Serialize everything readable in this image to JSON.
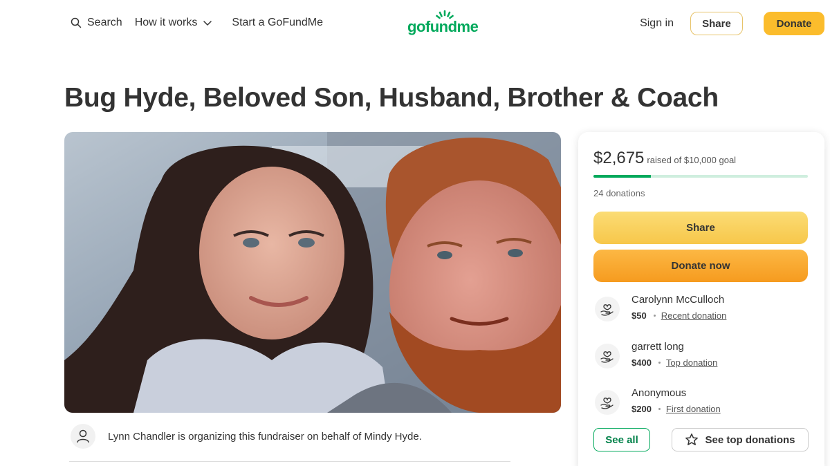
{
  "nav": {
    "search_label": "Search",
    "how_it_works_label": "How it works",
    "start_label": "Start a GoFundMe",
    "logo_text": "gofundme",
    "signin_label": "Sign in",
    "share_label": "Share",
    "donate_label": "Donate"
  },
  "campaign": {
    "title": "Bug Hyde, Beloved Son, Husband, Brother & Coach",
    "organizer_text": "Lynn Chandler is organizing this fundraiser on behalf of Mindy Hyde."
  },
  "donation_card": {
    "raised_amount": "$2,675",
    "goal_text": "raised of $10,000 goal",
    "progress_fraction": 0.2675,
    "donations_count": "24 donations",
    "share_label": "Share",
    "donate_label": "Donate now",
    "donors": [
      {
        "name": "Carolynn McCulloch",
        "amount": "$50",
        "tag": "Recent donation"
      },
      {
        "name": "garrett long",
        "amount": "$400",
        "tag": "Top donation"
      },
      {
        "name": "Anonymous",
        "amount": "$200",
        "tag": "First donation"
      }
    ],
    "see_all_label": "See all",
    "see_top_label": "See top donations"
  },
  "colors": {
    "brand_green": "#02a95c",
    "donate_yellow": "#fbbc2c",
    "donate_orange": "#f69b1f"
  }
}
